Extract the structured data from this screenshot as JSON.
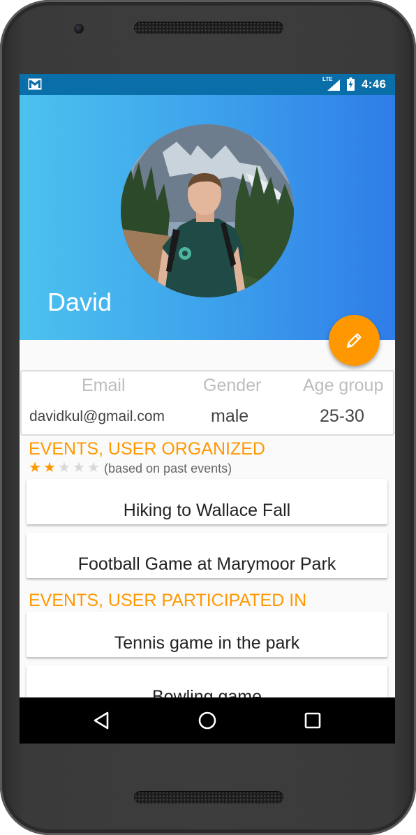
{
  "status_bar": {
    "notification_icon": "gmail-icon",
    "network_type": "LTE",
    "signal_icon": "signal-icon",
    "battery_icon": "battery-charging-icon",
    "time": "4:46"
  },
  "profile": {
    "name": "David",
    "avatar_icon": "profile-photo",
    "edit_icon": "pencil-icon",
    "fields": [
      {
        "label": "Email",
        "value": "davidkul@gmail.com"
      },
      {
        "label": "Gender",
        "value": "male"
      },
      {
        "label": "Age group",
        "value": "25-30"
      }
    ]
  },
  "organized": {
    "title": "EVENTS, USER ORGANIZED",
    "rating": 2,
    "rating_max": 5,
    "rating_note": "(based on past events)",
    "events": [
      "Hiking to Wallace Fall",
      "Football Game at Marymoor Park"
    ]
  },
  "participated": {
    "title": "EVENTS, USER PARTICIPATED IN",
    "events": [
      "Tennis game in the park",
      "Bowling game"
    ]
  },
  "nav": {
    "back_icon": "back-triangle-icon",
    "home_icon": "home-circle-icon",
    "recents_icon": "recents-square-icon"
  },
  "colors": {
    "accent": "#ff9800",
    "status_bar": "#0a6ea8",
    "header_start": "#4cc2ee",
    "header_end": "#2f7de8"
  }
}
